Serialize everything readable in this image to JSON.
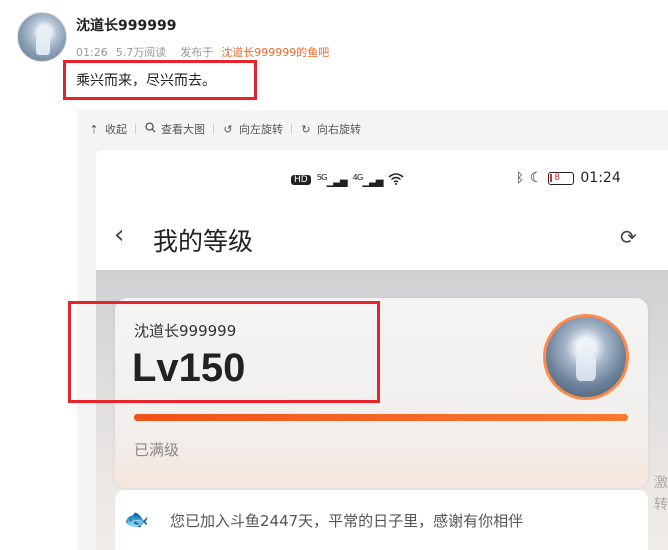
{
  "post": {
    "author": "沈道长999999",
    "time": "01:26",
    "views": "5.7万阅读",
    "posted_in_label": "发布于",
    "forum": "沈道长999999的鱼吧",
    "text": "乘兴而来，尽兴而去。"
  },
  "toolbar": {
    "items": [
      {
        "icon": "collapse-icon",
        "label": "收起"
      },
      {
        "icon": "search-icon",
        "label": "查看大图"
      },
      {
        "icon": "rotate-left-icon",
        "label": "向左旋转"
      },
      {
        "icon": "rotate-right-icon",
        "label": "向右旋转"
      }
    ]
  },
  "phone": {
    "status": {
      "hd": "HD",
      "sig1": "5G",
      "sig2": "4G",
      "battery": "8",
      "time": "01:24"
    },
    "nav_title": "我的等级",
    "card": {
      "username": "沈道长999999",
      "level": "Lv150",
      "progress": 1.0,
      "status": "已满级"
    },
    "footer_text": "您已加入斗鱼2447天，平常的日子里，感谢有你相伴",
    "side_text": [
      "激",
      "转"
    ]
  },
  "colors": {
    "accent": "#f26a2e",
    "highlight": "#e8232c",
    "progress": "#f25a1e"
  }
}
